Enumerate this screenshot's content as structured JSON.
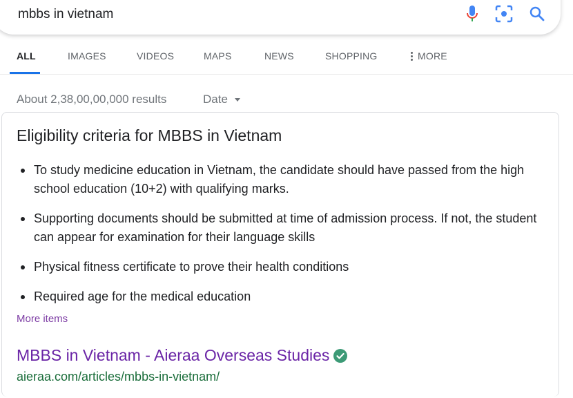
{
  "search": {
    "query": "mbbs in vietnam",
    "icons": [
      "mic-icon",
      "lens-icon",
      "search-icon"
    ]
  },
  "tabs": [
    {
      "label": "ALL",
      "active": true
    },
    {
      "label": "IMAGES",
      "active": false
    },
    {
      "label": "VIDEOS",
      "active": false
    },
    {
      "label": "MAPS",
      "active": false
    },
    {
      "label": "NEWS",
      "active": false
    },
    {
      "label": "SHOPPING",
      "active": false
    },
    {
      "label": "MORE",
      "active": false
    }
  ],
  "stats": {
    "results_text": "About 2,38,00,00,000 results",
    "date_filter": "Date"
  },
  "snippet": {
    "title": "Eligibility criteria for MBBS in Vietnam",
    "bullets": [
      "To study medicine education in Vietnam, the candidate should have passed from the high school education (10+2) with qualifying marks.",
      "Supporting documents should be submitted at time of admission process. If not, the student can appear for examination for their language skills",
      "Physical fitness certificate to prove their health conditions",
      "Required age for the medical education"
    ],
    "more_items": "More items"
  },
  "result": {
    "title": "MBBS in Vietnam - Aieraa Overseas Studies",
    "url": "aieraa.com/articles/mbbs-in-vietnam/",
    "verified_icon": "verified-check-icon"
  },
  "colors": {
    "accent": "#1a73e8",
    "visited_link": "#6a24a6",
    "url_green": "#1a6d3a",
    "verified_green": "#3c9a76"
  }
}
